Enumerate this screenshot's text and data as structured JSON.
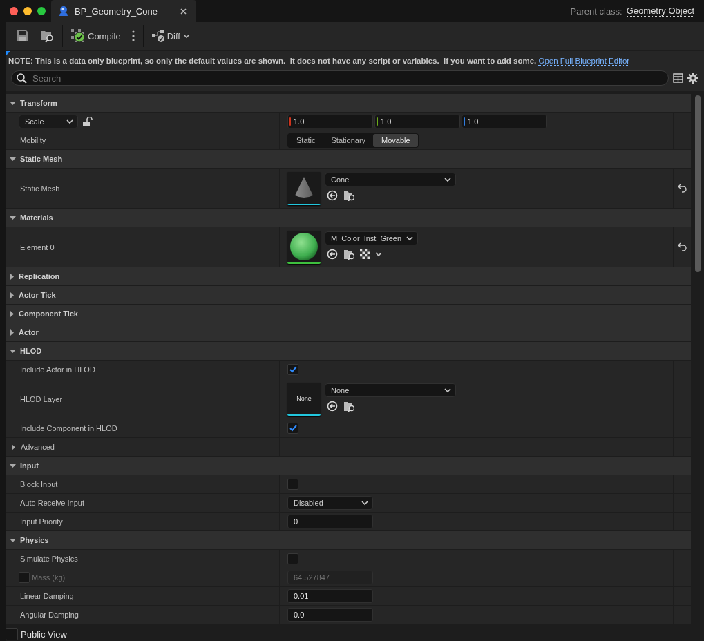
{
  "window": {
    "tab": {
      "title": "BP_Geometry_Cone"
    },
    "parent_class": {
      "label": "Parent class:",
      "value": "Geometry Object"
    }
  },
  "toolbar": {
    "compile_label": "Compile",
    "diff_label": "Diff"
  },
  "note": {
    "text": "NOTE: This is a data only blueprint, so only the default values are shown.  It does not have any script or variables.  If you want to add some,",
    "link": "Open Full Blueprint Editor"
  },
  "search": {
    "placeholder": "Search"
  },
  "sections": [
    {
      "title": "Transform",
      "expanded": true,
      "rows": [
        {
          "kind": "vector",
          "mode": "Scale",
          "locked": false,
          "values": [
            {
              "value": "1.0",
              "color": "#d0331c"
            },
            {
              "value": "1.0",
              "color": "#6cab19"
            },
            {
              "value": "1.0",
              "color": "#2f7de0"
            }
          ]
        },
        {
          "kind": "segmented",
          "label": "Mobility",
          "options": [
            {
              "label": "Static",
              "selected": false
            },
            {
              "label": "Stationary",
              "selected": false
            },
            {
              "label": "Movable",
              "selected": true
            }
          ]
        }
      ]
    },
    {
      "title": "Static Mesh",
      "expanded": true,
      "rows": [
        {
          "kind": "asset",
          "label": "Static Mesh",
          "thumbnail": {
            "kind": "cone"
          },
          "value": "Cone",
          "resettable": true
        }
      ]
    },
    {
      "title": "Materials",
      "expanded": true,
      "rows": [
        {
          "kind": "asset",
          "label": "Element 0",
          "thumbnail": {
            "kind": "sphere"
          },
          "value": "M_Color_Inst_Green",
          "resettable": true
        }
      ]
    },
    {
      "title": "Replication",
      "expanded": false
    },
    {
      "title": "Actor Tick",
      "expanded": false
    },
    {
      "title": "Component Tick",
      "expanded": false
    },
    {
      "title": "Actor",
      "expanded": false
    },
    {
      "title": "HLOD",
      "expanded": true,
      "rows": [
        {
          "kind": "checkbox",
          "label": "Include Actor in HLOD",
          "checked": true
        },
        {
          "kind": "asset",
          "label": "HLOD Layer",
          "thumbnail": {
            "kind": "empty",
            "text": "None"
          },
          "value": "None",
          "resettable": false
        },
        {
          "kind": "checkbox",
          "label": "Include Component in HLOD",
          "checked": true
        },
        {
          "kind": "subgroup",
          "label": "Advanced",
          "expanded": false
        }
      ]
    },
    {
      "title": "Input",
      "expanded": true,
      "rows": [
        {
          "kind": "checkbox",
          "label": "Block Input",
          "checked": false
        },
        {
          "kind": "dropdown",
          "label": "Auto Receive Input",
          "value": "Disabled"
        },
        {
          "kind": "number",
          "label": "Input Priority",
          "value": "0",
          "disabled": false
        }
      ]
    },
    {
      "title": "Physics",
      "expanded": true,
      "rows": [
        {
          "kind": "checkbox",
          "label": "Simulate Physics",
          "checked": false
        },
        {
          "kind": "number",
          "label": "Mass (kg)",
          "value": "64.527847",
          "disabled": true,
          "override_checked": false
        },
        {
          "kind": "number",
          "label": "Linear Damping",
          "value": "0.01",
          "disabled": false
        },
        {
          "kind": "number",
          "label": "Angular Damping",
          "value": "0.0",
          "disabled": false
        }
      ]
    }
  ],
  "footer": {
    "label": "Public View",
    "checked": false
  }
}
